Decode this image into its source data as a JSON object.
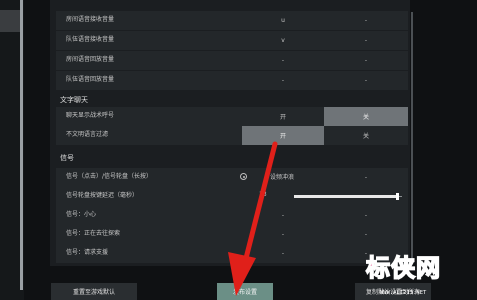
{
  "voice_rows": [
    {
      "label": "房间语音接收音量",
      "value1": "u",
      "value2": "-"
    },
    {
      "label": "队伍语音接收音量",
      "value1": "v",
      "value2": "-"
    },
    {
      "label": "房间语音回放音量",
      "value1": "-",
      "value2": "-"
    },
    {
      "label": "队伍语音回放音量",
      "value1": "-",
      "value2": "-"
    }
  ],
  "text_chat": {
    "section_title": "文字聊天",
    "rows": [
      {
        "label": "聊天显示战术呼号",
        "opt_on": "开",
        "opt_off": "关",
        "selected": "off"
      },
      {
        "label": "不文明语言过滤",
        "opt_on": "开",
        "opt_off": "关",
        "selected": "on"
      }
    ]
  },
  "signal": {
    "section_title": "信号",
    "rows": [
      {
        "label": "信号（点击）/信号轮盘（长按）",
        "inline_value": "设频冲浪",
        "col2": "-"
      },
      {
        "label": "信号轮盘按键延迟（毫秒）",
        "slider_value": "13",
        "slider_fraction": 0.95
      },
      {
        "label": "信号：小心",
        "col1": "-",
        "col2": "-"
      },
      {
        "label": "信号：正在去往探索",
        "col1": "-",
        "col2": "-"
      },
      {
        "label": "信号：请求支援",
        "col1": "-",
        "col2": "-"
      }
    ]
  },
  "footer": {
    "reset_label": "重置至游戏默认",
    "save_label": "发布设置",
    "restore_label": "复制默认设置到所有"
  },
  "watermark": {
    "text": "标侠网",
    "url": "WWW.ALI213.NET"
  },
  "colors": {
    "background": "#0f1113",
    "panel": "#1b1e21",
    "row": "#23272a",
    "selected": "#6f7478",
    "accent_button": "#6b8f86",
    "arrow": "#e0201a",
    "watermark": "#e94a8f"
  }
}
